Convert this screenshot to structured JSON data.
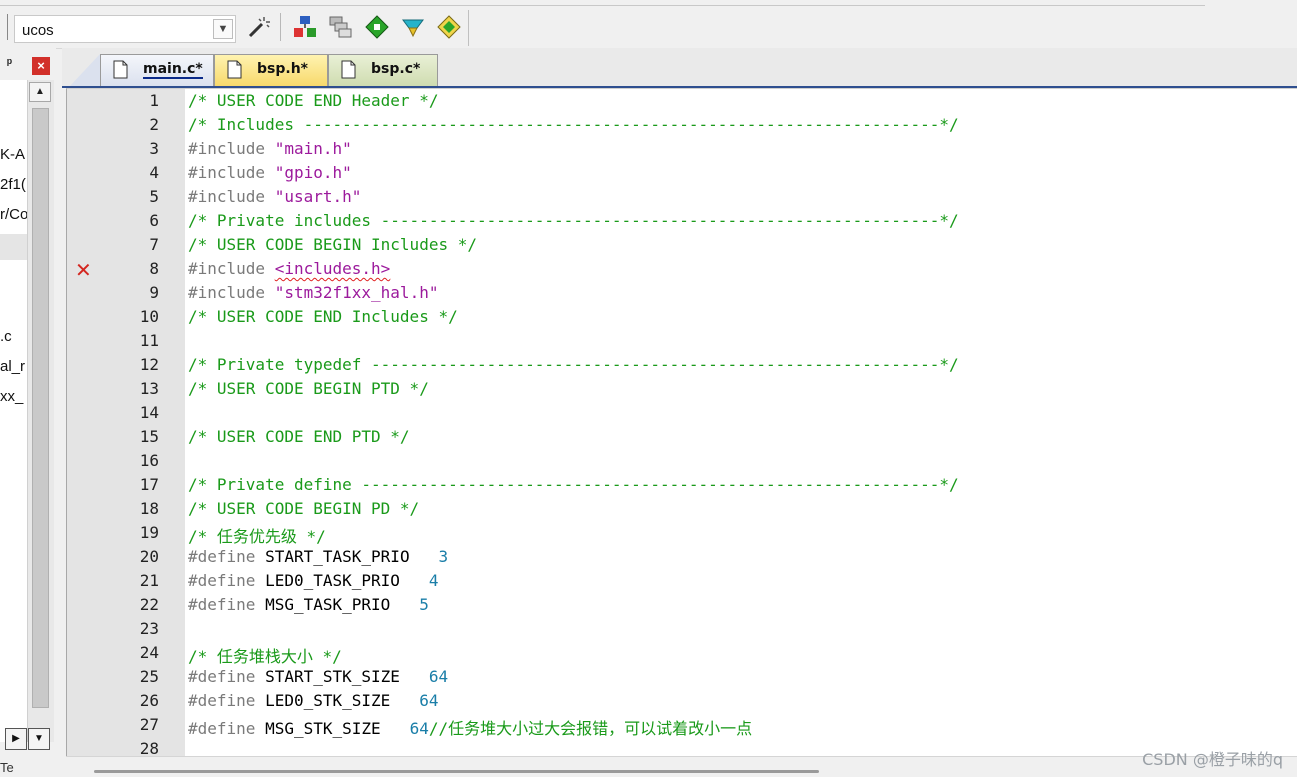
{
  "toolbar": {
    "target_combo_value": "ucos",
    "icons": [
      "manage-project-items-icon",
      "select-packs-icon",
      "manage-run-time-environment-icon",
      "magic-wand-icon",
      "pack-installer-icon",
      "component-icon"
    ]
  },
  "left_panel": {
    "pin_glyph": "ᵖ",
    "close_glyph": "×",
    "tree_fragments": [
      "K-A",
      "2f1(",
      "r/Co",
      ".c",
      "al_r",
      "xx_"
    ],
    "scroll_up_glyph": "▲",
    "hbtn_right_glyph": "▶",
    "hbtn_down_glyph": "▼",
    "bottom_fragment": "Te"
  },
  "tabs": [
    {
      "label": "main.c*",
      "active": true
    },
    {
      "label": "bsp.h*",
      "active": false
    },
    {
      "label": "bsp.c*",
      "active": false
    }
  ],
  "editor": {
    "error_line": 8,
    "error_glyph": "✕",
    "lines": [
      {
        "n": "1",
        "text": "/* USER CODE END Header */"
      },
      {
        "n": "2",
        "text": "/* Includes ------------------------------------------------------------------*/"
      },
      {
        "n": "3",
        "pre": "#include",
        "str": "\"main.h\""
      },
      {
        "n": "4",
        "pre": "#include",
        "str": "\"gpio.h\""
      },
      {
        "n": "5",
        "pre": "#include",
        "str": "\"usart.h\""
      },
      {
        "n": "6",
        "text": "/* Private includes ----------------------------------------------------------*/"
      },
      {
        "n": "7",
        "text": "/* USER CODE BEGIN Includes */"
      },
      {
        "n": "8",
        "pre": "#include",
        "str": "<includes.h>"
      },
      {
        "n": "9",
        "pre": "#include",
        "str": "\"stm32f1xx_hal.h\""
      },
      {
        "n": "10",
        "text": "/* USER CODE END Includes */"
      },
      {
        "n": "11",
        "text": ""
      },
      {
        "n": "12",
        "text": "/* Private typedef -----------------------------------------------------------*/"
      },
      {
        "n": "13",
        "text": "/* USER CODE BEGIN PTD */"
      },
      {
        "n": "14",
        "text": ""
      },
      {
        "n": "15",
        "text": "/* USER CODE END PTD */"
      },
      {
        "n": "16",
        "text": ""
      },
      {
        "n": "17",
        "text": "/* Private define ------------------------------------------------------------*/"
      },
      {
        "n": "18",
        "text": "/* USER CODE BEGIN PD */"
      },
      {
        "n": "19",
        "text": "/* 任务优先级 */"
      },
      {
        "n": "20",
        "pre": "#define",
        "id": "START_TASK_PRIO",
        "num": "3"
      },
      {
        "n": "21",
        "pre": "#define",
        "id": "LED0_TASK_PRIO",
        "num": "4"
      },
      {
        "n": "22",
        "pre": "#define",
        "id": "MSG_TASK_PRIO",
        "num": "5"
      },
      {
        "n": "23",
        "text": ""
      },
      {
        "n": "24",
        "text": "/* 任务堆栈大小 */"
      },
      {
        "n": "25",
        "pre": "#define",
        "id": "START_STK_SIZE",
        "num": "64"
      },
      {
        "n": "26",
        "pre": "#define",
        "id": "LED0_STK_SIZE",
        "num": "64"
      },
      {
        "n": "27",
        "pre": "#define",
        "id": "MSG_STK_SIZE",
        "num": "64",
        "trail": "//任务堆大小过大会报错，可以试着改小一点"
      },
      {
        "n": "28",
        "text": ""
      }
    ]
  },
  "watermark": "CSDN @橙子味的q",
  "colors": {
    "comment": "#1a9a1a",
    "preprocessor": "#7a7a7a",
    "string": "#9c1a9c",
    "number": "#1a7ea8",
    "error": "#d3261f"
  }
}
